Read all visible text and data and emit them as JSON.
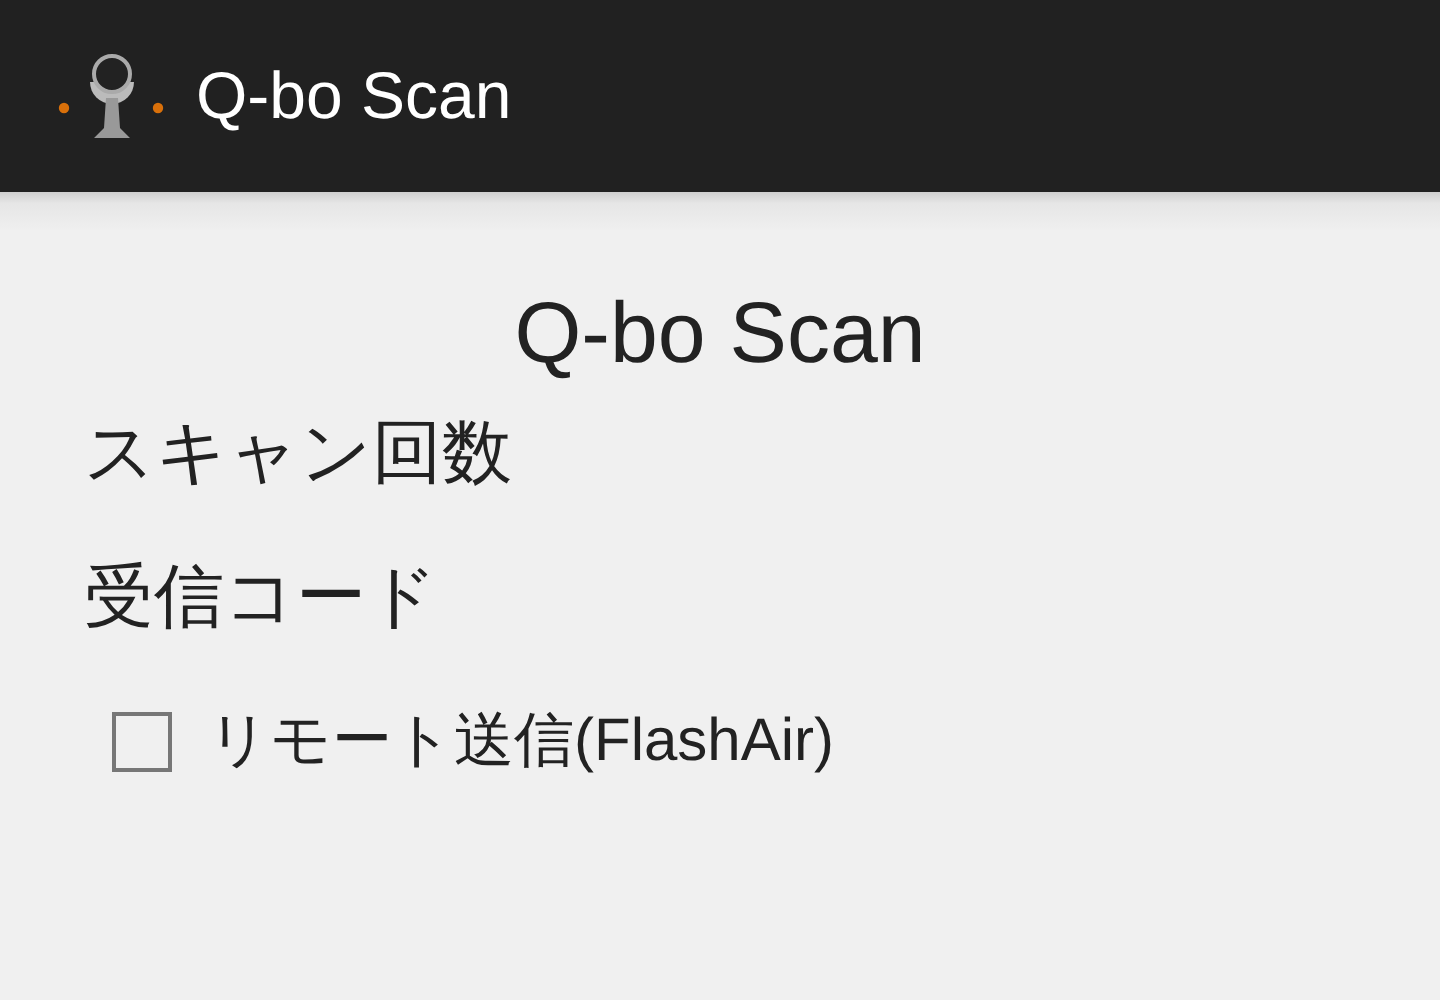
{
  "app_bar": {
    "title": "Q-bo Scan"
  },
  "heading": "Q-bo Scan",
  "labels": [
    "スキャン回数",
    "受信コード"
  ],
  "remote_send": {
    "label": "リモート送信(FlashAir)",
    "checked": false
  }
}
